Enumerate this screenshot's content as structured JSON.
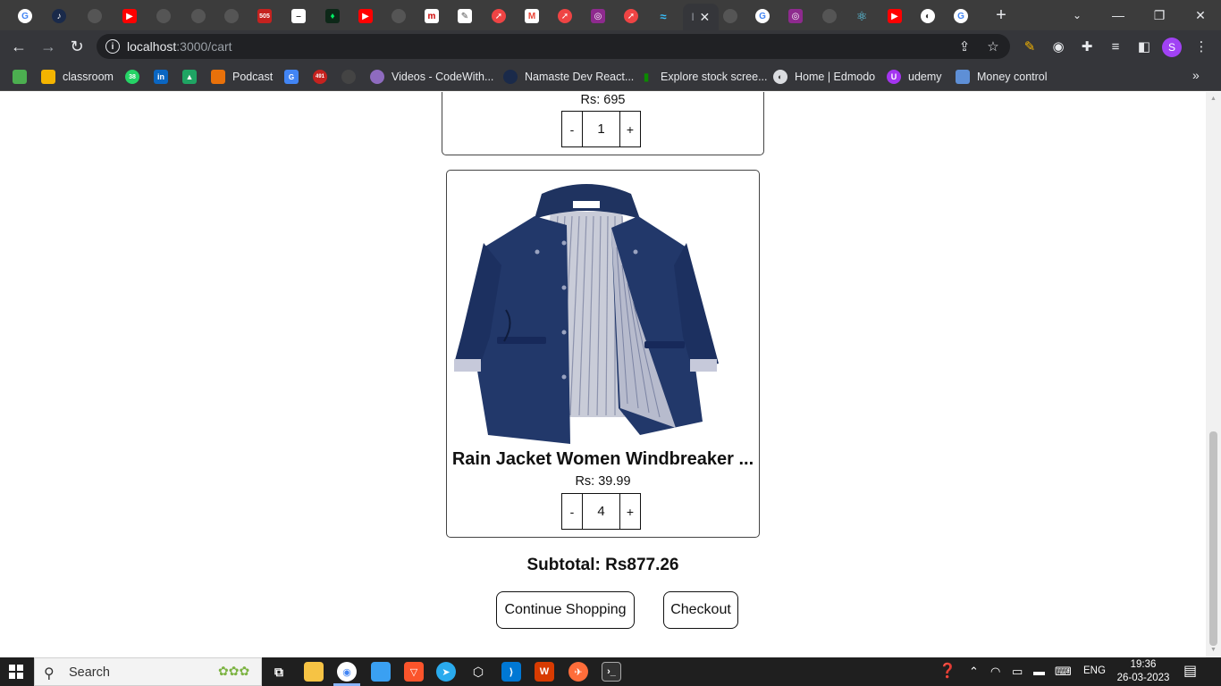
{
  "browser": {
    "active_tab_title": "l",
    "address": {
      "host": "localhost",
      "path": ":3000/cart"
    },
    "profile_initial": "S"
  },
  "bookmarks": [
    {
      "label": "classroom",
      "icon": "google-classroom-icon",
      "color": "#f4b400"
    },
    {
      "label": "",
      "icon": "whatsapp-icon",
      "color": "#25d366",
      "badge": "38"
    },
    {
      "label": "",
      "icon": "linkedin-icon",
      "color": "#0a66c2",
      "badge": "in"
    },
    {
      "label": "",
      "icon": "google-drive-icon",
      "color": "#1fa463"
    },
    {
      "label": "Podcast",
      "icon": "podcast-icon",
      "color": "#e8710a"
    },
    {
      "label": "",
      "icon": "google-translate-icon",
      "color": "#4285f4"
    },
    {
      "label": "",
      "icon": "calendar-badge-icon",
      "color": "#c5221f",
      "badge": "491"
    },
    {
      "label": "",
      "icon": "github-icon",
      "color": "#444"
    },
    {
      "label": "Videos - CodeWith...",
      "icon": "codewithharry-icon",
      "color": "#8e6bbf"
    },
    {
      "label": "Namaste Dev React...",
      "icon": "namaste-dev-icon",
      "color": "#1a2a4a"
    },
    {
      "label": "Explore stock scree...",
      "icon": "chart-bars-icon",
      "color": "#0b8a00"
    },
    {
      "label": "Home | Edmodo",
      "icon": "globe-icon",
      "color": "#dadce0"
    },
    {
      "label": "udemy",
      "icon": "udemy-icon",
      "color": "#a435f0"
    },
    {
      "label": "Money control",
      "icon": "moneycontrol-icon",
      "color": "#5e8fd6"
    }
  ],
  "cart": {
    "previous_item": {
      "price": "Rs: 695",
      "qty": "1"
    },
    "item": {
      "title": "Rain Jacket Women Windbreaker ...",
      "price": "Rs: 39.99",
      "qty": "4",
      "image": "navy-rain-jacket-image"
    },
    "decrement_label": "-",
    "increment_label": "+",
    "subtotal": "Subtotal: Rs877.26",
    "continue_label": "Continue Shopping",
    "checkout_label": "Checkout"
  },
  "taskbar": {
    "search_placeholder": "Search",
    "language": "ENG",
    "time": "19:36",
    "date": "26-03-2023"
  }
}
